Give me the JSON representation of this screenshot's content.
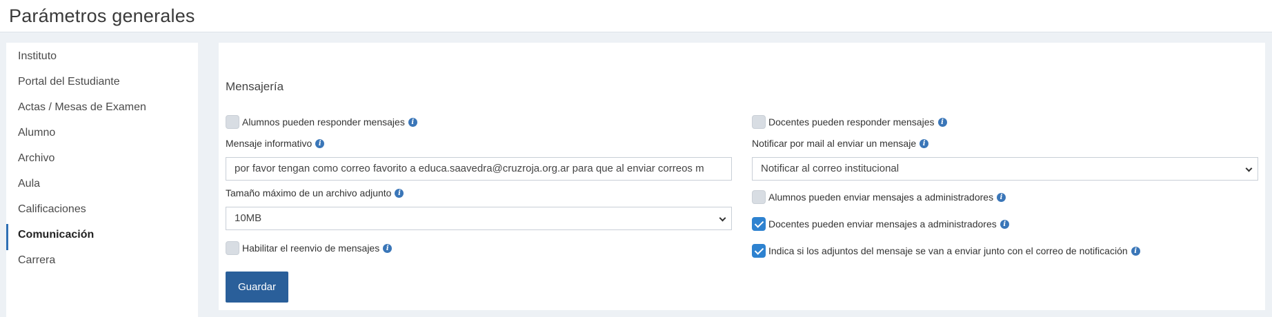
{
  "header": {
    "title": "Parámetros generales"
  },
  "sidebar": {
    "items": [
      {
        "label": "Instituto"
      },
      {
        "label": "Portal del Estudiante"
      },
      {
        "label": "Actas / Mesas de Examen"
      },
      {
        "label": "Alumno"
      },
      {
        "label": "Archivo"
      },
      {
        "label": "Aula"
      },
      {
        "label": "Calificaciones"
      },
      {
        "label": "Comunicación",
        "active": true
      },
      {
        "label": "Carrera"
      }
    ]
  },
  "main": {
    "section_title": "Mensajería",
    "left": {
      "alumnos_responder": {
        "label": "Alumnos pueden responder mensajes",
        "checked": false
      },
      "mensaje_informativo": {
        "label": "Mensaje informativo",
        "value": "por favor tengan como correo favorito a educa.saavedra@cruzroja.org.ar para que al enviar correos m"
      },
      "tamano_adjunto": {
        "label": "Tamaño máximo de un archivo adjunto",
        "value": "10MB"
      },
      "reenvio": {
        "label": "Habilitar el reenvio de mensajes",
        "checked": false
      }
    },
    "right": {
      "docentes_responder": {
        "label": "Docentes pueden responder mensajes",
        "checked": false
      },
      "notificar_mail": {
        "label": "Notificar por mail al enviar un mensaje",
        "value": "Notificar al correo institucional"
      },
      "alumnos_admin": {
        "label": "Alumnos pueden enviar mensajes a administradores",
        "checked": false
      },
      "docentes_admin": {
        "label": "Docentes pueden enviar mensajes a administradores",
        "checked": true
      },
      "adjuntos_notificacion": {
        "label": "Indica si los adjuntos del mensaje se van a enviar junto con el correo de notificación",
        "checked": true
      }
    },
    "save_label": "Guardar"
  },
  "icons": {
    "info": "info-icon",
    "caret": "chevron-down-icon"
  },
  "colors": {
    "accent": "#2e6fb4",
    "button": "#2a5f9a",
    "checkbox_on": "#2e82d0"
  }
}
